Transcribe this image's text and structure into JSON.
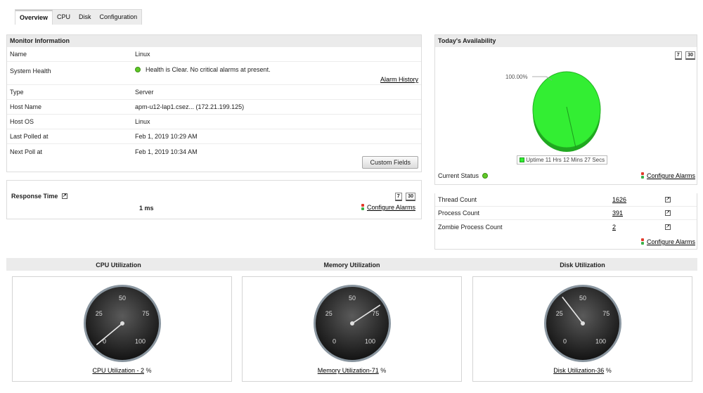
{
  "tabs": [
    "Overview",
    "CPU",
    "Disk",
    "Configuration"
  ],
  "monitor_info": {
    "title": "Monitor Information",
    "rows": [
      {
        "label": "Name",
        "value": "Linux"
      },
      {
        "label": "System Health",
        "value": "Health is Clear. No critical alarms at present."
      },
      {
        "label": "Type",
        "value": "Server"
      },
      {
        "label": "Host Name",
        "value": "apm-u12-lap1.csez... (172.21.199.125)"
      },
      {
        "label": "Host OS",
        "value": "Linux"
      },
      {
        "label": "Last Polled at",
        "value": "Feb 1, 2019 10:29 AM"
      },
      {
        "label": "Next Poll at",
        "value": "Feb 1, 2019 10:34 AM"
      }
    ],
    "alarm_history": "Alarm History",
    "custom_fields": "Custom Fields",
    "health_color": "#5fc926"
  },
  "response_time": {
    "label": "Response Time",
    "value": "1 ms",
    "period_7": "7",
    "period_30": "30",
    "configure": "Configure Alarms"
  },
  "availability": {
    "title": "Today's Availability",
    "period_7": "7",
    "period_30": "30",
    "pie_label": "100.00%",
    "uptime_percent": 100,
    "legend": "Uptime 11 Hrs 12 Mins 27 Secs",
    "current_status": "Current Status",
    "configure": "Configure Alarms",
    "uptime_color": "#33ee33"
  },
  "stats": {
    "rows": [
      {
        "label": "Thread Count",
        "value": "1626"
      },
      {
        "label": "Process Count",
        "value": "391"
      },
      {
        "label": "Zombie Process Count",
        "value": "2"
      }
    ],
    "configure": "Configure Alarms"
  },
  "gauges": [
    {
      "title": "CPU Utilization",
      "value": 2,
      "link": "CPU Utilization - 2",
      "unit": " %",
      "ticks": [
        "0",
        "25",
        "50",
        "75",
        "100"
      ]
    },
    {
      "title": "Memory Utilization",
      "value": 71,
      "link": "Memory Utilization-71",
      "unit": " %",
      "ticks": [
        "0",
        "25",
        "50",
        "75",
        "100"
      ]
    },
    {
      "title": "Disk Utilization",
      "value": 36,
      "link": "Disk Utilization-36",
      "unit": " %",
      "ticks": [
        "0",
        "25",
        "50",
        "75",
        "100"
      ]
    }
  ]
}
